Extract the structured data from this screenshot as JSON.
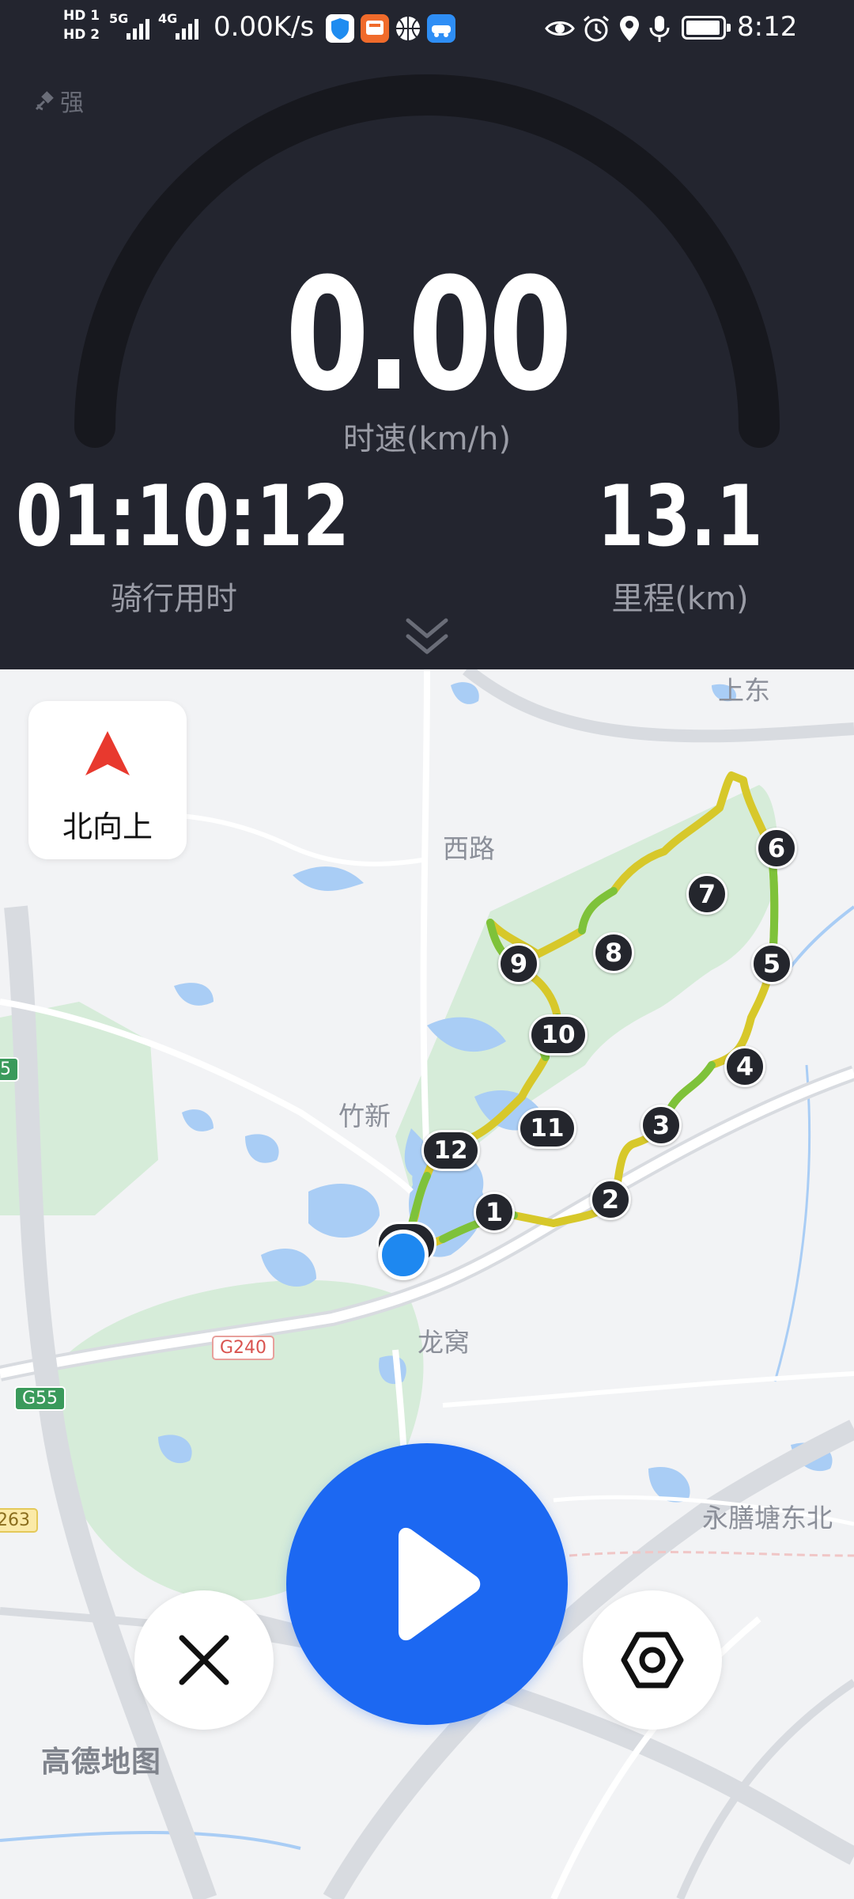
{
  "status_bar": {
    "hd1": "HD 1",
    "hd2": "HD 2",
    "net_5g": "5G",
    "net_4g": "4G",
    "net_speed": "0.00K/s",
    "time": "8:12"
  },
  "dashboard": {
    "gps_label": "强",
    "speed_value": "0.00",
    "speed_label": "时速(km/h)",
    "ride_time_value": "01:10:12",
    "ride_time_label": "骑行用时",
    "distance_value": "13.1",
    "distance_label": "里程(km)"
  },
  "map": {
    "north_button_label": "北向上",
    "labels": {
      "shangdong": "上东",
      "xilu": "西路",
      "zhuxin": "竹新",
      "longwo": "龙窝",
      "yongshan": "永膳塘东北"
    },
    "road_badges": {
      "g240": "G240",
      "g55": "G55",
      "g5": "5",
      "r263": "263"
    },
    "waypoints": [
      "1",
      "2",
      "3",
      "4",
      "5",
      "6",
      "7",
      "8",
      "9",
      "10",
      "11",
      "12"
    ],
    "brand": "高德地图"
  },
  "colors": {
    "dashboard_bg": "#23252f",
    "accent_blue": "#1c68f2",
    "route_green": "#7ec23a",
    "route_yellow": "#d7c82a",
    "north_red": "#e8392e",
    "map_bg": "#f2f3f5",
    "water": "#a9cdf5",
    "park": "#d6ecd9"
  }
}
